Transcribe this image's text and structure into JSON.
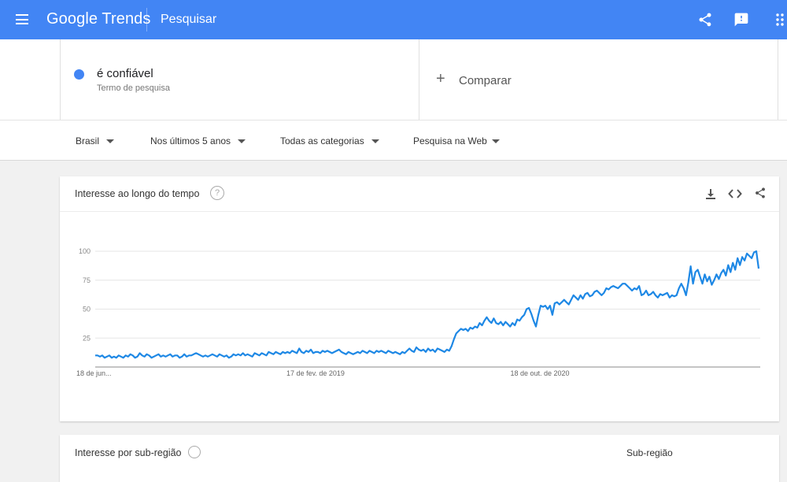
{
  "header": {
    "logo_google": "Google",
    "logo_trends": "Trends",
    "title": "Pesquisar",
    "icons": [
      "menu-icon",
      "share-icon",
      "feedback-icon",
      "apps-icon"
    ]
  },
  "term": {
    "name": "é confiável",
    "type": "Termo de pesquisa",
    "color": "#4285f4"
  },
  "compare": {
    "plus": "+",
    "label": "Comparar"
  },
  "filters": {
    "region": "Brasil",
    "period": "Nos últimos 5 anos",
    "category": "Todas as categorias",
    "search_type": "Pesquisa na Web"
  },
  "card": {
    "title": "Interesse ao longo do tempo",
    "help": "?",
    "icons": [
      "download-icon",
      "embed-icon",
      "share-icon"
    ]
  },
  "card2": {
    "title": "Interesse por sub-região",
    "sub_label": "Sub-região"
  },
  "chart_data": {
    "type": "line",
    "xlabels": [
      "18 de jun...",
      "17 de fev. de 2019",
      "18 de out. de 2020"
    ],
    "yticks": [
      25,
      50,
      75,
      100
    ],
    "ylim": [
      0,
      100
    ],
    "grid": true,
    "line_color": "#1e88e5",
    "series": [
      {
        "values": [
          10,
          10,
          9,
          10,
          8,
          9,
          10,
          8,
          9,
          8,
          10,
          9,
          8,
          10,
          9,
          11,
          10,
          8,
          9,
          12,
          10,
          9,
          11,
          10,
          8,
          9,
          10,
          11,
          9,
          10,
          9,
          10,
          11,
          9,
          10,
          10,
          8,
          9,
          11,
          9,
          10,
          10,
          11,
          12,
          11,
          10,
          9,
          10,
          9,
          10,
          11,
          10,
          9,
          11,
          10,
          9,
          10,
          8,
          9,
          11,
          10,
          11,
          10,
          12,
          10,
          11,
          10,
          9,
          12,
          11,
          10,
          12,
          11,
          10,
          13,
          12,
          11,
          13,
          12,
          11,
          13,
          12,
          13,
          12,
          14,
          13,
          12,
          16,
          13,
          12,
          14,
          13,
          15,
          12,
          13,
          13,
          12,
          14,
          13,
          14,
          13,
          12,
          13,
          14,
          15,
          13,
          12,
          11,
          13,
          12,
          11,
          12,
          13,
          12,
          14,
          13,
          12,
          14,
          13,
          12,
          14,
          13,
          14,
          13,
          12,
          14,
          13,
          12,
          13,
          12,
          11,
          13,
          12,
          14,
          16,
          14,
          13,
          17,
          15,
          14,
          15,
          13,
          16,
          14,
          15,
          13,
          16,
          15,
          14,
          13,
          15,
          14,
          18,
          24,
          29,
          31,
          33,
          32,
          33,
          31,
          34,
          33,
          35,
          34,
          38,
          36,
          40,
          43,
          40,
          38,
          42,
          38,
          37,
          39,
          36,
          39,
          37,
          35,
          38,
          36,
          41,
          40,
          43,
          45,
          50,
          51,
          46,
          40,
          35,
          45,
          53,
          52,
          53,
          50,
          53,
          45,
          55,
          56,
          54,
          56,
          58,
          56,
          54,
          58,
          62,
          60,
          58,
          62,
          59,
          63,
          64,
          61,
          62,
          65,
          66,
          64,
          62,
          64,
          68,
          67,
          69,
          70,
          69,
          68,
          70,
          72,
          72,
          70,
          68,
          66,
          68,
          67,
          70,
          62,
          63,
          66,
          62,
          63,
          65,
          62,
          60,
          63,
          62,
          63,
          64,
          60,
          62,
          61,
          62,
          68,
          72,
          68,
          62,
          73,
          87,
          72,
          82,
          84,
          78,
          72,
          80,
          74,
          78,
          71,
          75,
          80,
          76,
          81,
          84,
          79,
          88,
          82,
          90,
          84,
          94,
          88,
          95,
          92,
          98,
          96,
          94,
          99,
          100,
          85
        ]
      }
    ]
  }
}
